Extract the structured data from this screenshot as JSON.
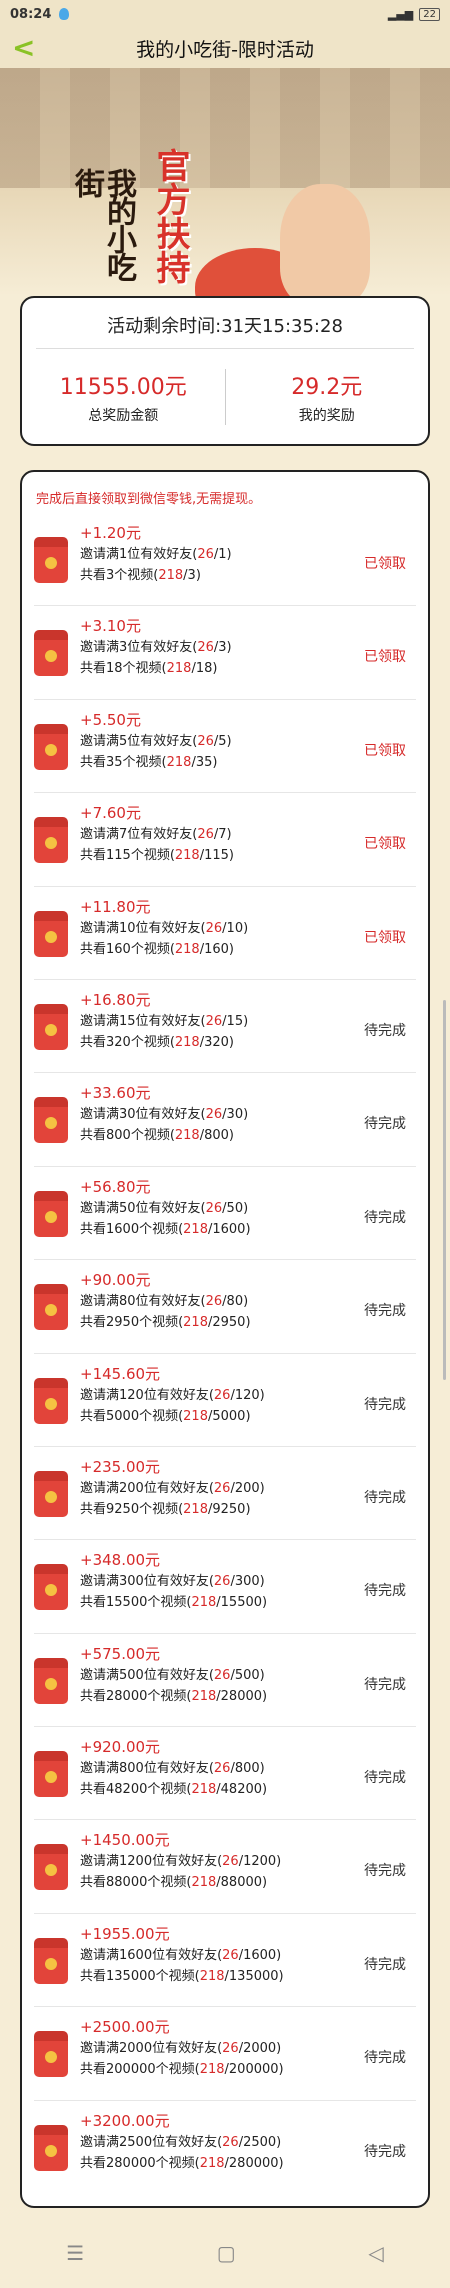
{
  "status_bar": {
    "time": "08:24",
    "battery": "22"
  },
  "header": {
    "back": "<",
    "title": "我的小吃街-限时活动"
  },
  "banner": {
    "logo": "我的小吃街",
    "slogan": "官方扶持"
  },
  "stats": {
    "timer_label": "活动剩余时间:",
    "timer_value": "31天15:35:28",
    "total_value": "11555.00元",
    "total_label": "总奖励金额",
    "mine_value": "29.2元",
    "mine_label": "我的奖励"
  },
  "notice": "完成后直接领取到微信零钱,无需提现。",
  "tasks": [
    {
      "amount": "+1.20元",
      "invite": "邀请满1位有效好友(",
      "ic": "26",
      "is": "/1)",
      "watch": "共看3个视频(",
      "wc": "218",
      "ws": "/3)",
      "status": "已领取"
    },
    {
      "amount": "+3.10元",
      "invite": "邀请满3位有效好友(",
      "ic": "26",
      "is": "/3)",
      "watch": "共看18个视频(",
      "wc": "218",
      "ws": "/18)",
      "status": "已领取"
    },
    {
      "amount": "+5.50元",
      "invite": "邀请满5位有效好友(",
      "ic": "26",
      "is": "/5)",
      "watch": "共看35个视频(",
      "wc": "218",
      "ws": "/35)",
      "status": "已领取"
    },
    {
      "amount": "+7.60元",
      "invite": "邀请满7位有效好友(",
      "ic": "26",
      "is": "/7)",
      "watch": "共看115个视频(",
      "wc": "218",
      "ws": "/115)",
      "status": "已领取"
    },
    {
      "amount": "+11.80元",
      "invite": "邀请满10位有效好友(",
      "ic": "26",
      "is": "/10)",
      "watch": "共看160个视频(",
      "wc": "218",
      "ws": "/160)",
      "status": "已领取"
    },
    {
      "amount": "+16.80元",
      "invite": "邀请满15位有效好友(",
      "ic": "26",
      "is": "/15)",
      "watch": "共看320个视频(",
      "wc": "218",
      "ws": "/320)",
      "status": "待完成"
    },
    {
      "amount": "+33.60元",
      "invite": "邀请满30位有效好友(",
      "ic": "26",
      "is": "/30)",
      "watch": "共看800个视频(",
      "wc": "218",
      "ws": "/800)",
      "status": "待完成"
    },
    {
      "amount": "+56.80元",
      "invite": "邀请满50位有效好友(",
      "ic": "26",
      "is": "/50)",
      "watch": "共看1600个视频(",
      "wc": "218",
      "ws": "/1600)",
      "status": "待完成"
    },
    {
      "amount": "+90.00元",
      "invite": "邀请满80位有效好友(",
      "ic": "26",
      "is": "/80)",
      "watch": "共看2950个视频(",
      "wc": "218",
      "ws": "/2950)",
      "status": "待完成"
    },
    {
      "amount": "+145.60元",
      "invite": "邀请满120位有效好友(",
      "ic": "26",
      "is": "/120)",
      "watch": "共看5000个视频(",
      "wc": "218",
      "ws": "/5000)",
      "status": "待完成"
    },
    {
      "amount": "+235.00元",
      "invite": "邀请满200位有效好友(",
      "ic": "26",
      "is": "/200)",
      "watch": "共看9250个视频(",
      "wc": "218",
      "ws": "/9250)",
      "status": "待完成"
    },
    {
      "amount": "+348.00元",
      "invite": "邀请满300位有效好友(",
      "ic": "26",
      "is": "/300)",
      "watch": "共看15500个视频(",
      "wc": "218",
      "ws": "/15500)",
      "status": "待完成"
    },
    {
      "amount": "+575.00元",
      "invite": "邀请满500位有效好友(",
      "ic": "26",
      "is": "/500)",
      "watch": "共看28000个视频(",
      "wc": "218",
      "ws": "/28000)",
      "status": "待完成"
    },
    {
      "amount": "+920.00元",
      "invite": "邀请满800位有效好友(",
      "ic": "26",
      "is": "/800)",
      "watch": "共看48200个视频(",
      "wc": "218",
      "ws": "/48200)",
      "status": "待完成"
    },
    {
      "amount": "+1450.00元",
      "invite": "邀请满1200位有效好友(",
      "ic": "26",
      "is": "/1200)",
      "watch": "共看88000个视频(",
      "wc": "218",
      "ws": "/88000)",
      "status": "待完成"
    },
    {
      "amount": "+1955.00元",
      "invite": "邀请满1600位有效好友(",
      "ic": "26",
      "is": "/1600)",
      "watch": "共看135000个视频(",
      "wc": "218",
      "ws": "/135000)",
      "status": "待完成"
    },
    {
      "amount": "+2500.00元",
      "invite": "邀请满2000位有效好友(",
      "ic": "26",
      "is": "/2000)",
      "watch": "共看200000个视频(",
      "wc": "218",
      "ws": "/200000)",
      "status": "待完成"
    },
    {
      "amount": "+3200.00元",
      "invite": "邀请满2500位有效好友(",
      "ic": "26",
      "is": "/2500)",
      "watch": "共看280000个视频(",
      "wc": "218",
      "ws": "/280000)",
      "status": "待完成"
    }
  ],
  "navbar": {
    "menu": "☰",
    "home": "▢",
    "back": "◁"
  }
}
